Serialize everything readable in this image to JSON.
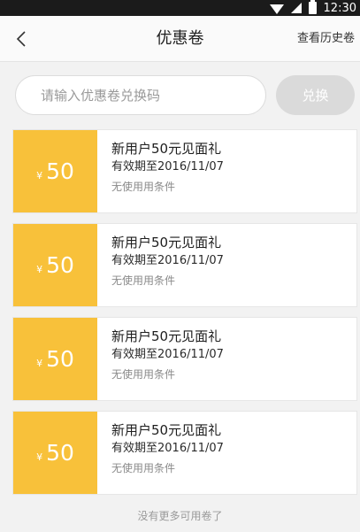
{
  "status_bar": {
    "time": "12:30",
    "icons": [
      "wifi-icon",
      "signal-icon",
      "battery-icon"
    ]
  },
  "header": {
    "back_icon": "chevron-left-icon",
    "title": "优惠卷",
    "history_link": "查看历史卷"
  },
  "redeem": {
    "placeholder": "请输入优惠卷兑换码",
    "button_label": "兑换"
  },
  "coupons": [
    {
      "currency": "¥",
      "amount": "50",
      "title": "新用户50元见面礼",
      "validity": "有效期至2016/11/07",
      "condition": "无使用用条件"
    },
    {
      "currency": "¥",
      "amount": "50",
      "title": "新用户50元见面礼",
      "validity": "有效期至2016/11/07",
      "condition": "无使用用条件"
    },
    {
      "currency": "¥",
      "amount": "50",
      "title": "新用户50元见面礼",
      "validity": "有效期至2016/11/07",
      "condition": "无使用用条件"
    },
    {
      "currency": "¥",
      "amount": "50",
      "title": "新用户50元见面礼",
      "validity": "有效期至2016/11/07",
      "condition": "无使用用条件"
    }
  ],
  "footer": {
    "list_end_text": "没有更多可用卷了"
  },
  "colors": {
    "accent": "#f8c13a",
    "disabled_button": "#dadada",
    "background": "#f2f2f2"
  }
}
